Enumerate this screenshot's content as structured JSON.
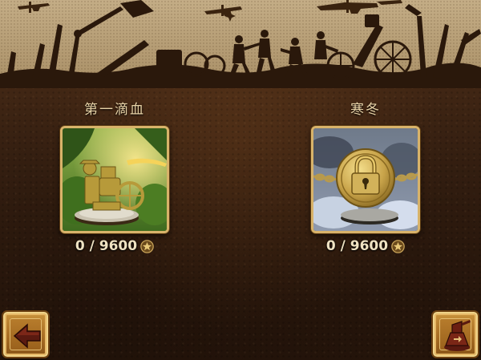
{
  "levels": [
    {
      "title": "第一滴血",
      "score": "0 / 9600",
      "locked": false
    },
    {
      "title": "寒冬",
      "score": "0 / 9600",
      "locked": true
    }
  ],
  "icons": {
    "back": "arrow-left-icon",
    "base": "base-camp-icon",
    "star": "star-icon",
    "lock": "padlock-icon"
  },
  "colors": {
    "title_text": "#e7d2a6",
    "frame_gold": "#d8b36a",
    "button_gold": "#c8923c"
  }
}
